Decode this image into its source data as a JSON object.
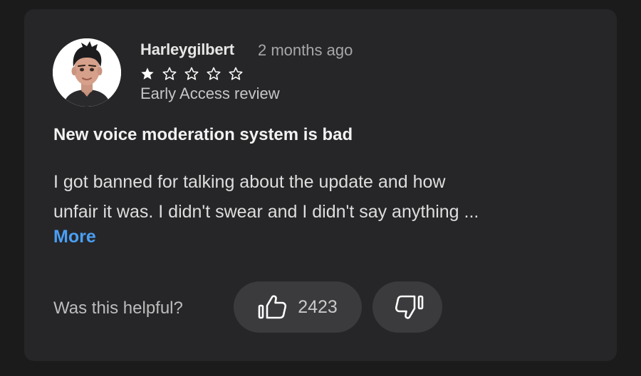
{
  "review": {
    "user_name": "Harleygilbert",
    "date": "2 months ago",
    "rating": 1,
    "rating_max": 5,
    "tag": "Early Access review",
    "title": "New voice moderation system is bad",
    "body_lines": [
      "I got banned for talking about the update and how",
      "unfair it was. I didn't swear and I didn't say anything ..."
    ],
    "more_label": "More"
  },
  "feedback": {
    "question": "Was this helpful?",
    "helpful_count": "2423"
  },
  "icons": {
    "star_filled": "star-filled-icon",
    "star_empty": "star-outline-icon",
    "thumbs_up": "thumbs-up-icon",
    "thumbs_down": "thumbs-down-icon"
  },
  "colors": {
    "background": "#1b1b1c",
    "card": "#262628",
    "link": "#4a9ff5",
    "button": "#3b3b3d"
  }
}
